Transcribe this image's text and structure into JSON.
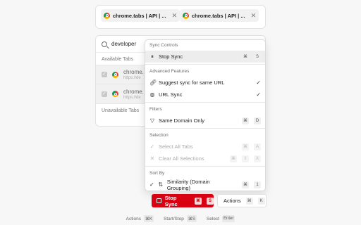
{
  "selected_tabs": [
    {
      "label": "chrome.tabs  |  API  | ...",
      "close": "✕"
    },
    {
      "label": "chrome.tabs  |  API  | ...",
      "close": "✕"
    }
  ],
  "search": {
    "value": "developer"
  },
  "available_tabs_label": "Available Tabs",
  "unavailable_tabs_label": "Unavailable Tabs",
  "available_tabs": [
    {
      "title": "chrome.",
      "url": "https://de"
    },
    {
      "title": "chrome.",
      "url": "https://de"
    }
  ],
  "menu": {
    "sync_controls": {
      "label": "Sync Controls",
      "stop_sync": {
        "label": "Stop Sync",
        "keys": [
          "⌘",
          "S"
        ]
      }
    },
    "advanced": {
      "label": "Advanced Features",
      "suggest": {
        "label": "Suggest sync for same URL",
        "check": "✓"
      },
      "url_sync": {
        "label": "URL Sync",
        "check": "✓"
      }
    },
    "filters": {
      "label": "Filters",
      "same_domain": {
        "label": "Same Domain Only",
        "keys": [
          "⌘",
          "D"
        ]
      }
    },
    "selection": {
      "label": "Selection",
      "select_all": {
        "label": "Select All Tabs",
        "keys": [
          "⌘",
          "A"
        ]
      },
      "clear_all": {
        "label": "Clear All Selections",
        "keys": [
          "⌘",
          "⇧",
          "X"
        ]
      }
    },
    "sort": {
      "label": "Sort By",
      "similarity": {
        "label": "Similarity (Domain Grouping)",
        "keys": [
          "⌘",
          "1"
        ]
      }
    }
  },
  "buttons": {
    "stop_sync": {
      "label": "Stop Sync",
      "keys": [
        "⌘",
        "S"
      ]
    },
    "actions": {
      "label": "Actions",
      "keys": [
        "⌘",
        "K"
      ]
    }
  },
  "footer": {
    "actions": {
      "label": "Actions",
      "key": "⌘K"
    },
    "start_stop": {
      "label": "Start/Stop",
      "key": "⌘S"
    },
    "select": {
      "label": "Select",
      "key": "Enter"
    }
  },
  "colors": {
    "accent": "#d90012"
  }
}
